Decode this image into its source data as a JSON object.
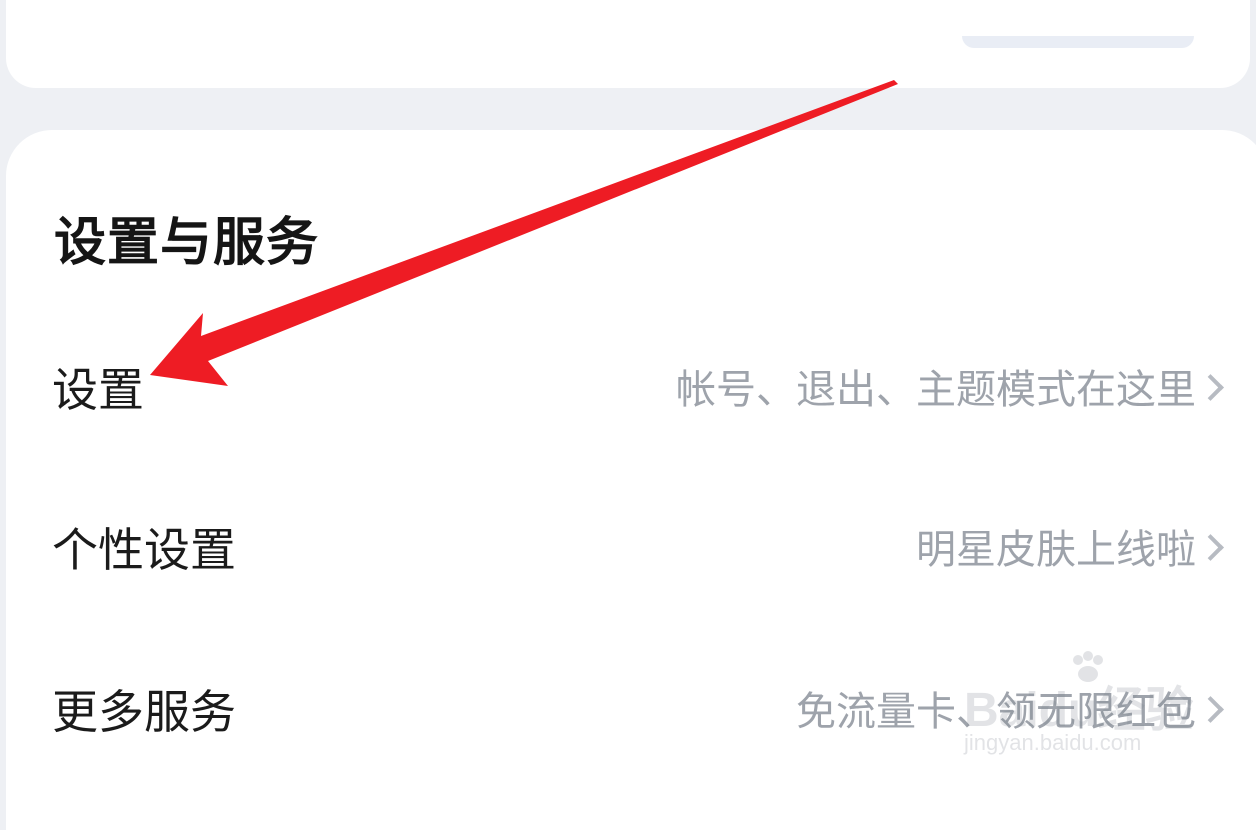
{
  "section": {
    "title": "设置与服务",
    "rows": [
      {
        "label": "设置",
        "hint": "帐号、退出、主题模式在这里",
        "icon": "chevron-right-icon"
      },
      {
        "label": "个性设置",
        "hint": "明星皮肤上线啦",
        "icon": "chevron-right-icon"
      },
      {
        "label": "更多服务",
        "hint": "免流量卡、领无限红包",
        "icon": "chevron-right-icon"
      }
    ]
  },
  "annotation": {
    "arrow_color": "#ee1c24"
  },
  "watermark": {
    "brand": "Baidu经验",
    "url": "jingyan.baidu.com"
  },
  "colors": {
    "background": "#eef0f4",
    "card": "#ffffff",
    "title": "#151515",
    "label": "#1b1b1b",
    "hint": "#9ea3ab",
    "chevron": "#b7bbc2"
  }
}
